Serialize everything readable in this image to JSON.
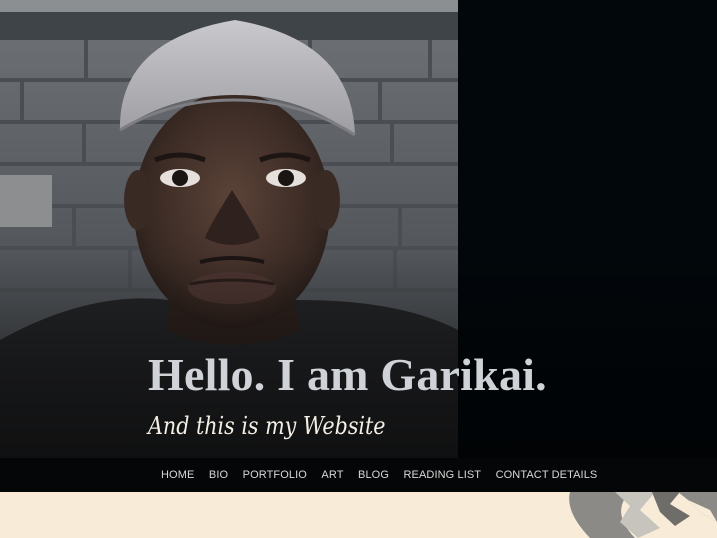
{
  "hero": {
    "headline": "Hello. I am Garikai.",
    "subline": "And this is my Website",
    "photo_alt": "portrait-photo"
  },
  "nav": {
    "items": [
      {
        "label": "HOME"
      },
      {
        "label": "BIO"
      },
      {
        "label": "PORTFOLIO"
      },
      {
        "label": "ART"
      },
      {
        "label": "BLOG"
      },
      {
        "label": "READING LIST"
      },
      {
        "label": "CONTACT DETAILS"
      }
    ]
  },
  "colors": {
    "hero_background": "#02070b",
    "nav_background": "#050607",
    "nav_text": "#d8d8d8",
    "headline_text": "#cfd2d6",
    "content_background": "#f8ecd9"
  }
}
